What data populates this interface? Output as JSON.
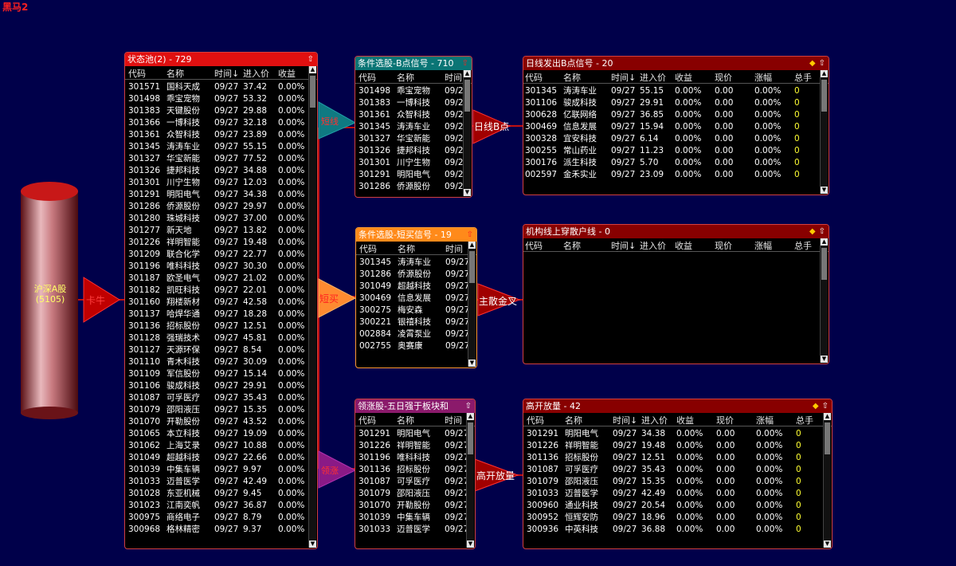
{
  "app": {
    "title": "黑马2"
  },
  "source": {
    "label": "沪深A股",
    "count": "(5105)"
  },
  "connectors": {
    "c1": "卡牛",
    "c2": "短线",
    "c3": "短买",
    "c4": "领涨",
    "c5": "日线B点",
    "c6": "主散金叉",
    "c7": "高开放量"
  },
  "icons": {
    "diamond": "diamond-icon",
    "up": "up-arrow-icon",
    "scroll_up": "scroll-up-icon",
    "scroll_down": "scroll-down-icon"
  },
  "colors": {
    "bg": "#00004a",
    "red_header": "#e01010",
    "teal_header": "#0a7575",
    "orange_header": "#ff8a1a",
    "purple_header": "#8b1a6b",
    "dark_header": "#880000"
  },
  "panels": {
    "pool": {
      "title": "状态池(2) - 729",
      "headers": [
        "代码",
        "名称",
        "时间↓",
        "进入价",
        "收益"
      ],
      "rows": [
        [
          "301571",
          "国科天成",
          "09/27",
          "37.42",
          "0.00%"
        ],
        [
          "301498",
          "乖宝宠物",
          "09/27",
          "53.32",
          "0.00%"
        ],
        [
          "301383",
          "天键股份",
          "09/27",
          "29.88",
          "0.00%"
        ],
        [
          "301366",
          "一博科技",
          "09/27",
          "32.18",
          "0.00%"
        ],
        [
          "301361",
          "众智科技",
          "09/27",
          "23.89",
          "0.00%"
        ],
        [
          "301345",
          "涛涛车业",
          "09/27",
          "55.15",
          "0.00%"
        ],
        [
          "301327",
          "华宝新能",
          "09/27",
          "77.52",
          "0.00%"
        ],
        [
          "301326",
          "捷邦科技",
          "09/27",
          "34.88",
          "0.00%"
        ],
        [
          "301301",
          "川宁生物",
          "09/27",
          "12.03",
          "0.00%"
        ],
        [
          "301291",
          "明阳电气",
          "09/27",
          "34.38",
          "0.00%"
        ],
        [
          "301286",
          "侨源股份",
          "09/27",
          "29.97",
          "0.00%"
        ],
        [
          "301280",
          "珠城科技",
          "09/27",
          "37.00",
          "0.00%"
        ],
        [
          "301277",
          "新天地",
          "09/27",
          "13.82",
          "0.00%"
        ],
        [
          "301226",
          "祥明智能",
          "09/27",
          "19.48",
          "0.00%"
        ],
        [
          "301209",
          "联合化学",
          "09/27",
          "22.77",
          "0.00%"
        ],
        [
          "301196",
          "唯科科技",
          "09/27",
          "30.30",
          "0.00%"
        ],
        [
          "301187",
          "欧圣电气",
          "09/27",
          "21.02",
          "0.00%"
        ],
        [
          "301182",
          "凯旺科技",
          "09/27",
          "22.01",
          "0.00%"
        ],
        [
          "301160",
          "翔楼新材",
          "09/27",
          "42.58",
          "0.00%"
        ],
        [
          "301137",
          "哈焊华通",
          "09/27",
          "18.28",
          "0.00%"
        ],
        [
          "301136",
          "招标股份",
          "09/27",
          "12.51",
          "0.00%"
        ],
        [
          "301128",
          "强瑞技术",
          "09/27",
          "45.81",
          "0.00%"
        ],
        [
          "301127",
          "天源环保",
          "09/27",
          "8.54",
          "0.00%"
        ],
        [
          "301110",
          "青木科技",
          "09/27",
          "30.09",
          "0.00%"
        ],
        [
          "301109",
          "军信股份",
          "09/27",
          "15.14",
          "0.00%"
        ],
        [
          "301106",
          "骏成科技",
          "09/27",
          "29.91",
          "0.00%"
        ],
        [
          "301087",
          "可孚医疗",
          "09/27",
          "35.43",
          "0.00%"
        ],
        [
          "301079",
          "邵阳液压",
          "09/27",
          "15.35",
          "0.00%"
        ],
        [
          "301070",
          "开勒股份",
          "09/27",
          "43.52",
          "0.00%"
        ],
        [
          "301065",
          "本立科技",
          "09/27",
          "19.09",
          "0.00%"
        ],
        [
          "301062",
          "上海艾录",
          "09/27",
          "10.88",
          "0.00%"
        ],
        [
          "301049",
          "超越科技",
          "09/27",
          "22.66",
          "0.00%"
        ],
        [
          "301039",
          "中集车辆",
          "09/27",
          "9.97",
          "0.00%"
        ],
        [
          "301033",
          "迈普医学",
          "09/27",
          "42.49",
          "0.00%"
        ],
        [
          "301028",
          "东亚机械",
          "09/27",
          "9.45",
          "0.00%"
        ],
        [
          "301023",
          "江南奕帆",
          "09/27",
          "36.87",
          "0.00%"
        ],
        [
          "300975",
          "商络电子",
          "09/27",
          "8.79",
          "0.00%"
        ],
        [
          "300968",
          "格林精密",
          "09/27",
          "9.37",
          "0.00%"
        ]
      ]
    },
    "b_signal": {
      "title": "条件选股-B点信号 - 710",
      "headers": [
        "代码",
        "名称",
        "时间"
      ],
      "rows": [
        [
          "301498",
          "乖宝宠物",
          "09/2"
        ],
        [
          "301383",
          "一博科技",
          "09/2"
        ],
        [
          "301361",
          "众智科技",
          "09/2"
        ],
        [
          "301345",
          "涛涛车业",
          "09/2"
        ],
        [
          "301327",
          "华宝新能",
          "09/2"
        ],
        [
          "301326",
          "捷邦科技",
          "09/2"
        ],
        [
          "301301",
          "川宁生物",
          "09/2"
        ],
        [
          "301291",
          "明阳电气",
          "09/2"
        ],
        [
          "301286",
          "侨源股份",
          "09/2"
        ]
      ]
    },
    "short_buy": {
      "title": "条件选股-短买信号 - 19",
      "headers": [
        "代码",
        "名称",
        "时间"
      ],
      "rows": [
        [
          "301345",
          "涛涛车业",
          "09/27"
        ],
        [
          "301286",
          "侨源股份",
          "09/27"
        ],
        [
          "301049",
          "超越科技",
          "09/27"
        ],
        [
          "300469",
          "信息发展",
          "09/27"
        ],
        [
          "300275",
          "梅安森",
          "09/27"
        ],
        [
          "300221",
          "银禧科技",
          "09/27"
        ],
        [
          "002884",
          "凌霄泵业",
          "09/27"
        ],
        [
          "002755",
          "奥赛康",
          "09/27"
        ]
      ]
    },
    "leader": {
      "title": "领涨股-五日强于板块和",
      "headers": [
        "代码",
        "名称",
        "时间"
      ],
      "rows": [
        [
          "301291",
          "明阳电气",
          "09/27"
        ],
        [
          "301226",
          "祥明智能",
          "09/27"
        ],
        [
          "301196",
          "唯科科技",
          "09/27"
        ],
        [
          "301136",
          "招标股份",
          "09/27"
        ],
        [
          "301087",
          "可孚医疗",
          "09/27"
        ],
        [
          "301079",
          "邵阳液压",
          "09/27"
        ],
        [
          "301070",
          "开勒股份",
          "09/27"
        ],
        [
          "301039",
          "中集车辆",
          "09/27"
        ],
        [
          "301033",
          "迈普医学",
          "09/27"
        ]
      ]
    },
    "daily_b": {
      "title": "日线发出B点信号 - 20",
      "headers": [
        "代码",
        "名称",
        "时间↓",
        "进入价",
        "收益",
        "现价",
        "涨幅",
        "总手"
      ],
      "rows": [
        [
          "301345",
          "涛涛车业",
          "09/27",
          "55.15",
          "0.00%",
          "0.00",
          "0.00%",
          "0"
        ],
        [
          "301106",
          "骏成科技",
          "09/27",
          "29.91",
          "0.00%",
          "0.00",
          "0.00%",
          "0"
        ],
        [
          "300628",
          "亿联网络",
          "09/27",
          "36.85",
          "0.00%",
          "0.00",
          "0.00%",
          "0"
        ],
        [
          "300469",
          "信息发展",
          "09/27",
          "15.94",
          "0.00%",
          "0.00",
          "0.00%",
          "0"
        ],
        [
          "300328",
          "宜安科技",
          "09/27",
          "6.14",
          "0.00%",
          "0.00",
          "0.00%",
          "0"
        ],
        [
          "300255",
          "常山药业",
          "09/27",
          "11.23",
          "0.00%",
          "0.00",
          "0.00%",
          "0"
        ],
        [
          "300176",
          "派生科技",
          "09/27",
          "5.70",
          "0.00%",
          "0.00",
          "0.00%",
          "0"
        ],
        [
          "002597",
          "金禾实业",
          "09/27",
          "23.09",
          "0.00%",
          "0.00",
          "0.00%",
          "0"
        ]
      ]
    },
    "inst": {
      "title": "机构线上穿散户线 - 0",
      "headers": [
        "代码",
        "名称",
        "时间↓",
        "进入价",
        "收益",
        "现价",
        "涨幅",
        "总手"
      ],
      "rows": []
    },
    "high_open": {
      "title": "高开放量 - 42",
      "headers": [
        "代码",
        "名称",
        "时间↓",
        "进入价",
        "收益",
        "现价",
        "涨幅",
        "总手"
      ],
      "rows": [
        [
          "301291",
          "明阳电气",
          "09/27",
          "34.38",
          "0.00%",
          "0.00",
          "0.00%",
          "0"
        ],
        [
          "301226",
          "祥明智能",
          "09/27",
          "19.48",
          "0.00%",
          "0.00",
          "0.00%",
          "0"
        ],
        [
          "301136",
          "招标股份",
          "09/27",
          "12.51",
          "0.00%",
          "0.00",
          "0.00%",
          "0"
        ],
        [
          "301087",
          "可孚医疗",
          "09/27",
          "35.43",
          "0.00%",
          "0.00",
          "0.00%",
          "0"
        ],
        [
          "301079",
          "邵阳液压",
          "09/27",
          "15.35",
          "0.00%",
          "0.00",
          "0.00%",
          "0"
        ],
        [
          "301033",
          "迈普医学",
          "09/27",
          "42.49",
          "0.00%",
          "0.00",
          "0.00%",
          "0"
        ],
        [
          "300960",
          "通业科技",
          "09/27",
          "20.54",
          "0.00%",
          "0.00",
          "0.00%",
          "0"
        ],
        [
          "300952",
          "恒辉安防",
          "09/27",
          "18.96",
          "0.00%",
          "0.00",
          "0.00%",
          "0"
        ],
        [
          "300936",
          "中英科技",
          "09/27",
          "36.88",
          "0.00%",
          "0.00",
          "0.00%",
          "0"
        ]
      ]
    }
  }
}
